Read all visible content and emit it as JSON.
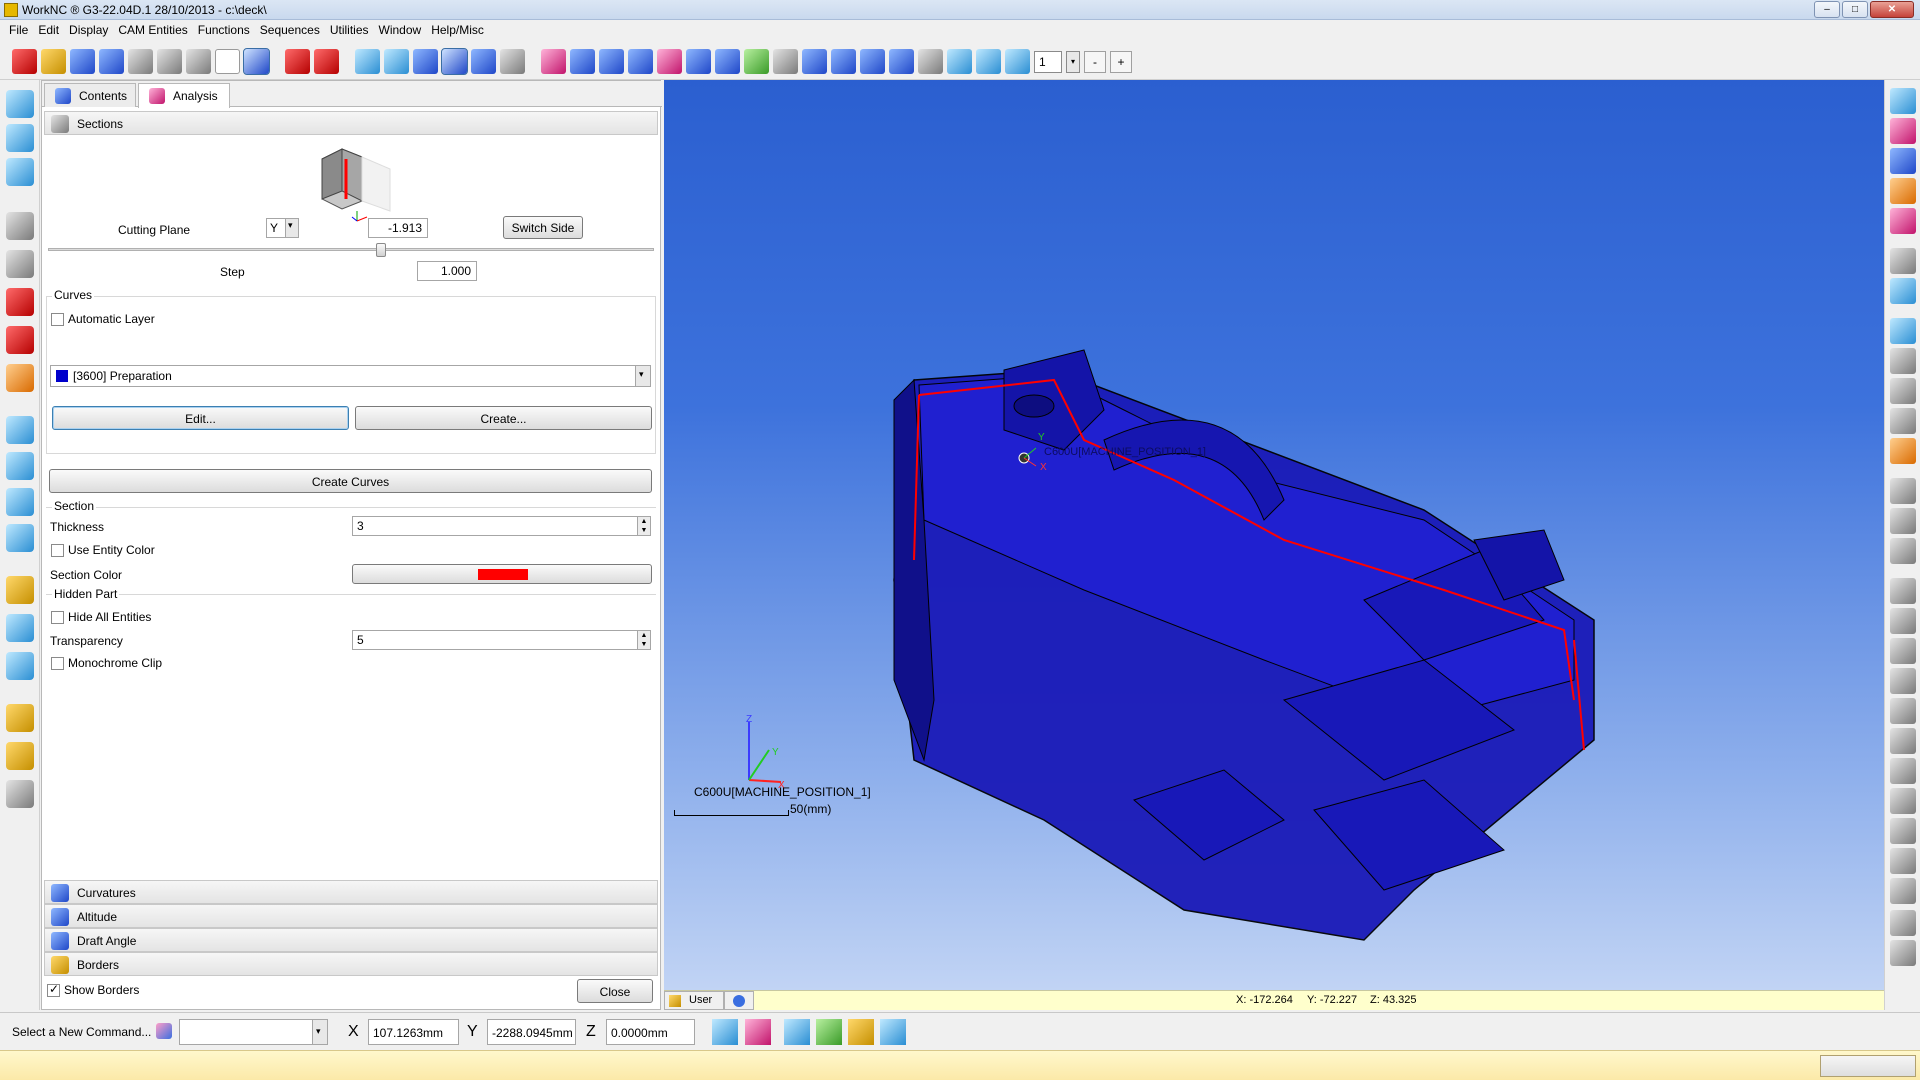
{
  "window": {
    "title": "WorkNC ® G3-22.04D.1   28/10/2013 - c:\\deck\\",
    "minimize": "‒",
    "maximize": "□",
    "close": "✕"
  },
  "menu": [
    "File",
    "Edit",
    "Display",
    "CAM Entities",
    "Functions",
    "Sequences",
    "Utilities",
    "Window",
    "Help/Misc"
  ],
  "toolbar": {
    "zoom_value": "1",
    "zoom_dropdown": "▾",
    "zoom_minus": "-",
    "zoom_plus": "+"
  },
  "panel": {
    "tabs": [
      {
        "label": "Contents",
        "icon": "contents-icon"
      },
      {
        "label": "Analysis",
        "icon": "analysis-icon"
      }
    ],
    "active_tab": "Analysis",
    "sections_header": "Sections",
    "cutting_plane": {
      "label": "Cutting Plane",
      "axis": "Y",
      "axis_dropdown": "▾",
      "value": "-1.913",
      "switch_side": "Switch Side",
      "slider_percent": 55
    },
    "step": {
      "label": "Step",
      "value": "1.000"
    },
    "curves": {
      "title": "Curves",
      "automatic_layer": {
        "label": "Automatic Layer",
        "checked": false
      },
      "layer_select": "[3600] Preparation",
      "layer_color": "#0000cc",
      "layer_dropdown": "▾",
      "edit_button": "Edit...",
      "create_button": "Create...",
      "create_curves_button": "Create Curves"
    },
    "section": {
      "title": "Section",
      "thickness_label": "Thickness",
      "thickness_value": "3",
      "use_entity_color": {
        "label": "Use Entity Color",
        "checked": false
      },
      "section_color_label": "Section Color",
      "section_color": "#ff0000"
    },
    "hidden_part": {
      "title": "Hidden Part",
      "hide_all": {
        "label": "Hide All Entities",
        "checked": false
      },
      "transparency_label": "Transparency",
      "transparency_value": "5",
      "monochrome_clip": {
        "label": "Monochrome Clip",
        "checked": false
      }
    },
    "bottom_sections": [
      "Curvatures",
      "Altitude",
      "Draft Angle",
      "Borders"
    ],
    "show_borders": {
      "label": "Show Borders",
      "checked": true
    },
    "close_button": "Close"
  },
  "viewport": {
    "part_color": "#1a1ab8",
    "section_line_color": "#ff0000",
    "triad_label": "C600U[MACHINE_POSITION_1]",
    "part_label": "C600U[MACHINE_POSITION_1]",
    "axis_x": "X",
    "axis_y": "Y",
    "axis_z": "Z",
    "scale_label": "50(mm)",
    "view_mode": "User",
    "coords": {
      "x": "X: -172.264",
      "y": "Y: -72.227",
      "z": "Z: 43.325"
    }
  },
  "command_bar": {
    "prompt": "Select a New Command...",
    "dropdown": "▾",
    "x_label": "X",
    "x_value": "107.1263mm",
    "y_label": "Y",
    "y_value": "-2288.0945mm",
    "z_label": "Z",
    "z_value": "0.0000mm"
  }
}
